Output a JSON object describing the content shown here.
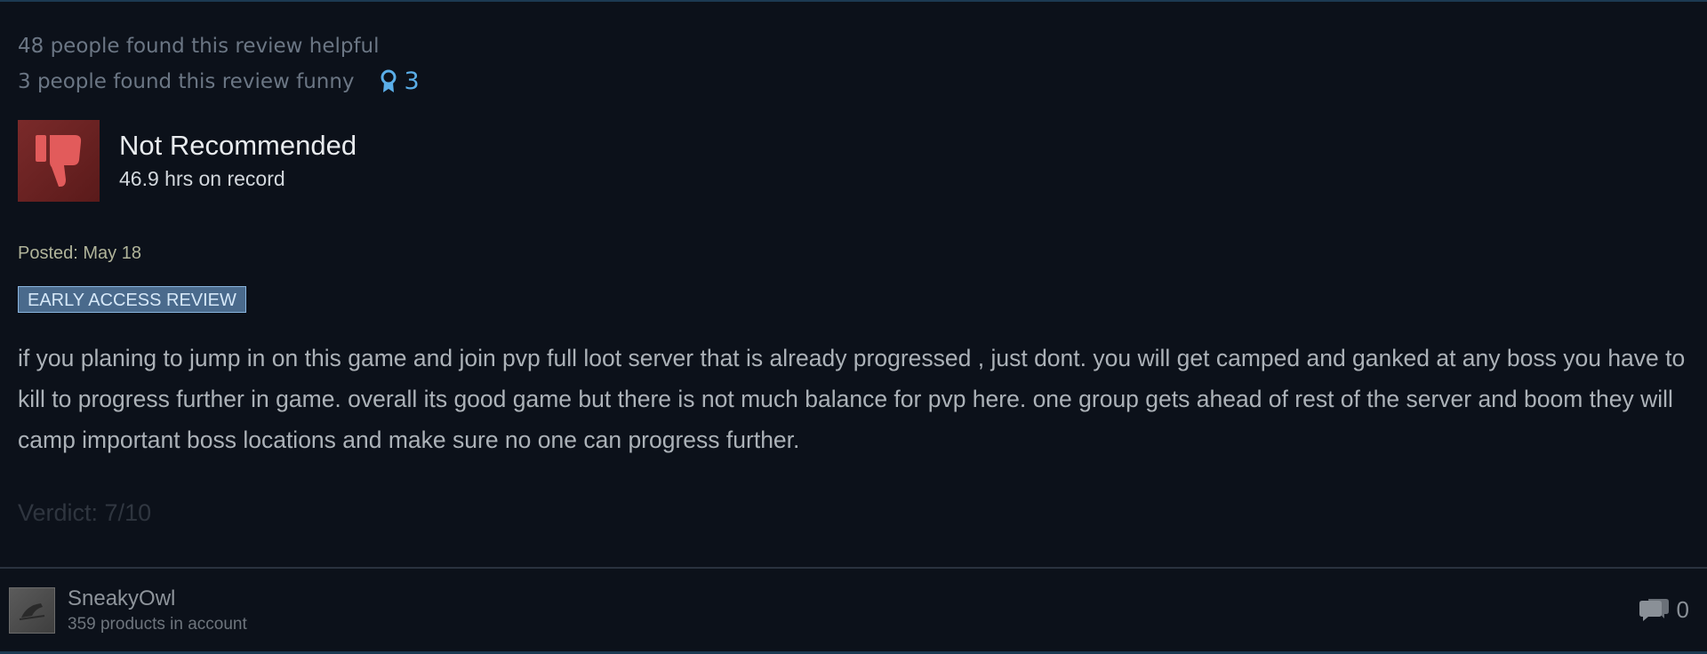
{
  "review": {
    "helpful_text": "48 people found this review helpful",
    "funny_text": "3 people found this review funny",
    "award_icon": "award-ribbon-icon",
    "award_count": "3",
    "verdict": "Not Recommended",
    "verdict_icon": "thumbs-down-icon",
    "hours": "46.9 hrs on record",
    "posted": "Posted: May 18",
    "badge": "EARLY ACCESS REVIEW",
    "body": "if you planing to jump in on this game and join pvp full loot server that is already progressed , just dont. you will get camped and ganked at any boss you have to kill to progress further in game. overall its good game but there is not much balance for pvp here. one group gets ahead of rest of the server and boom they will camp important boss locations and make sure no one can progress further.",
    "verdict_line": "Verdict: 7/10"
  },
  "author": {
    "name": "SneakyOwl",
    "products": "359 products in account",
    "avatar_icon": "owl-avatar-icon"
  },
  "comments": {
    "icon": "comment-bubbles-icon",
    "count": "0"
  },
  "colors": {
    "background": "#0c111a",
    "not_recommended_box": "#7a2a2a",
    "thumb": "#e25b5b",
    "award_blue": "#5aaee8",
    "badge_bg": "#4a6a8c"
  }
}
